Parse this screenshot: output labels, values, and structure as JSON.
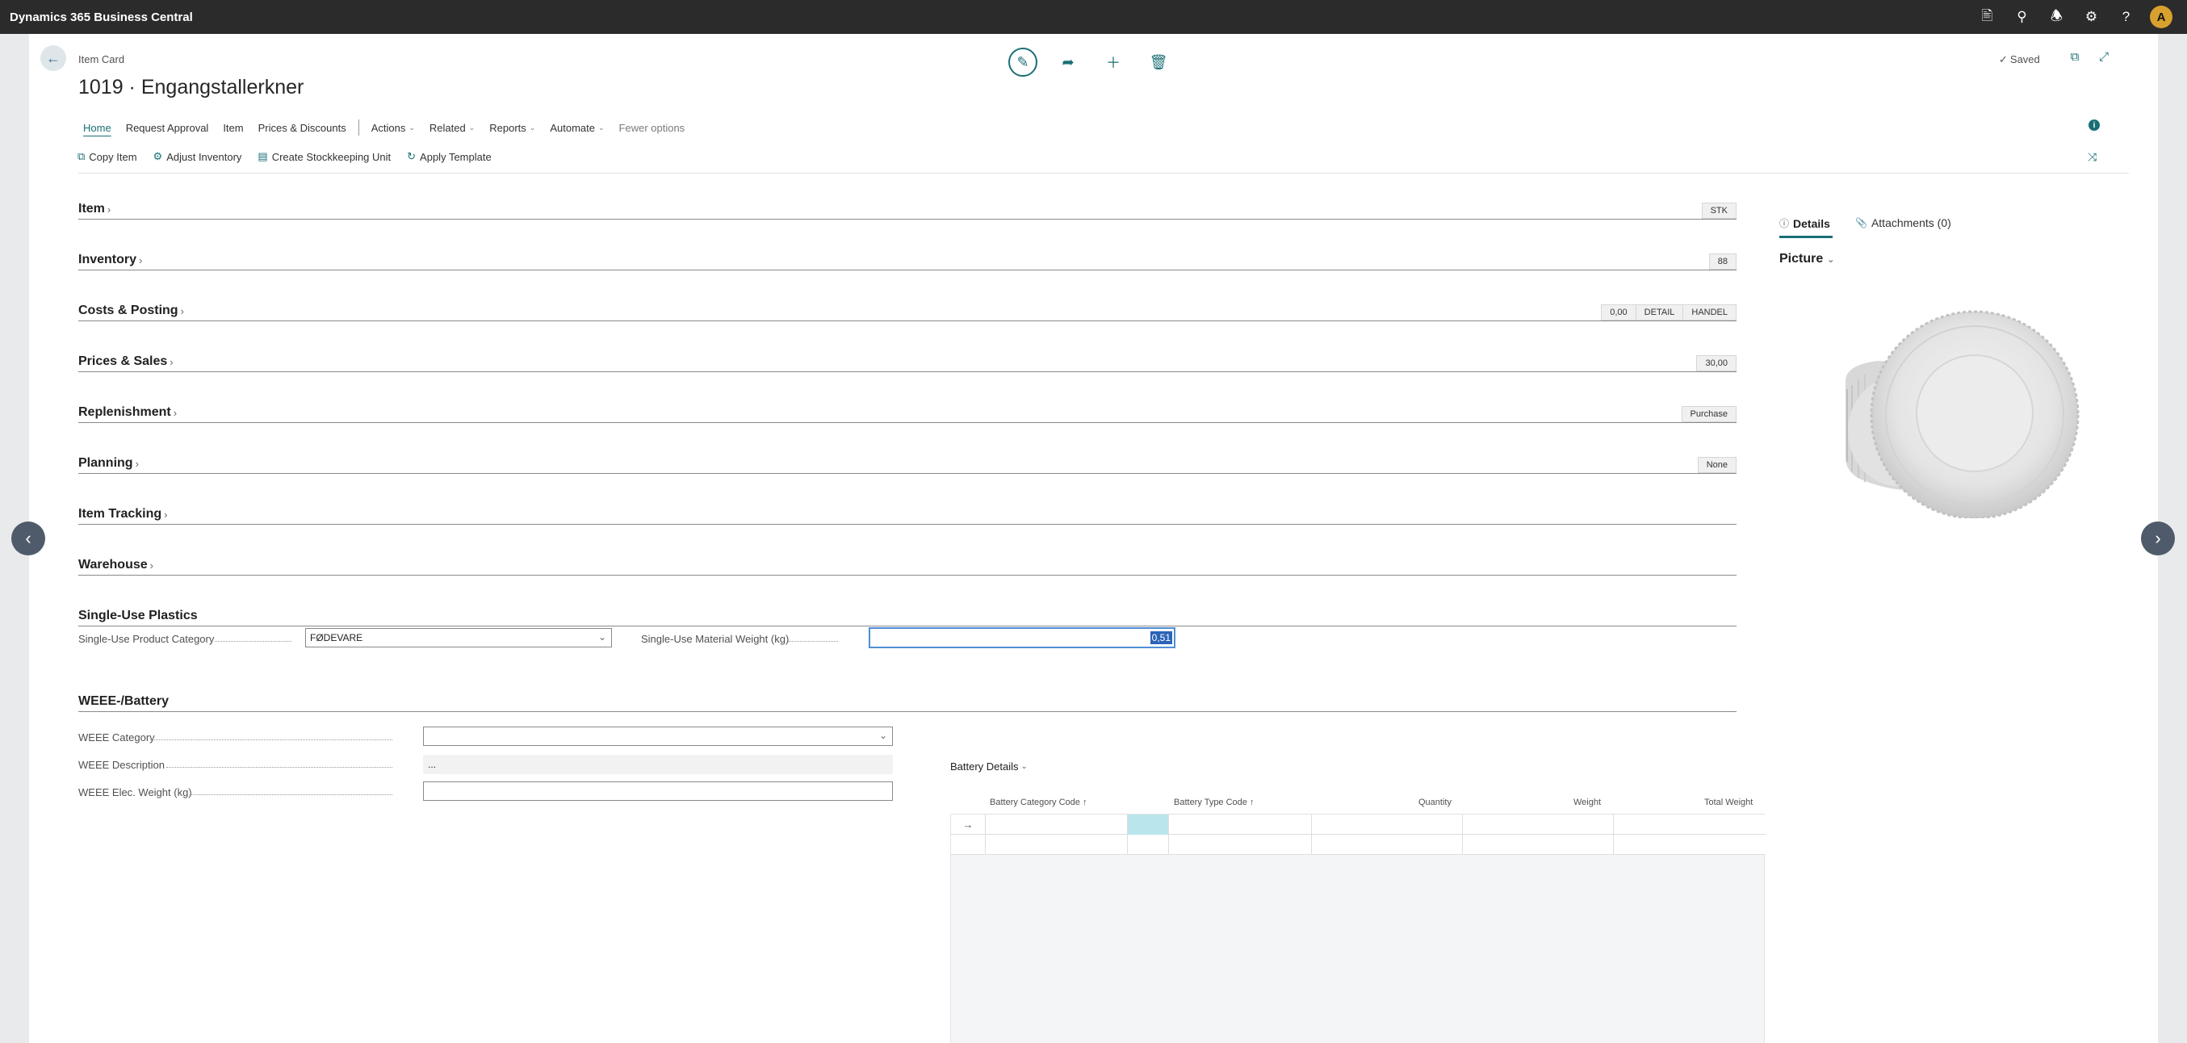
{
  "app": {
    "title": "Dynamics 365 Business Central",
    "user_initial": "A"
  },
  "header": {
    "caption": "Item Card",
    "title": "1019 · Engangstallerkner",
    "saved": "Saved"
  },
  "menu": {
    "home": "Home",
    "request_approval": "Request Approval",
    "item": "Item",
    "prices_discounts": "Prices & Discounts",
    "actions": "Actions",
    "related": "Related",
    "reports": "Reports",
    "automate": "Automate",
    "fewer_options": "Fewer options"
  },
  "actionbar": {
    "copy_item": "Copy Item",
    "adjust_inventory": "Adjust Inventory",
    "create_sku": "Create Stockkeeping Unit",
    "apply_template": "Apply Template"
  },
  "fasttabs": [
    {
      "title": "Item",
      "promoted": [
        "STK"
      ]
    },
    {
      "title": "Inventory",
      "promoted": [
        "88"
      ]
    },
    {
      "title": "Costs & Posting",
      "promoted": [
        "0,00",
        "DETAIL",
        "HANDEL"
      ]
    },
    {
      "title": "Prices & Sales",
      "promoted": [
        "30,00"
      ]
    },
    {
      "title": "Replenishment",
      "promoted": [
        "Purchase"
      ]
    },
    {
      "title": "Planning",
      "promoted": [
        "None"
      ]
    },
    {
      "title": "Item Tracking",
      "promoted": []
    },
    {
      "title": "Warehouse",
      "promoted": []
    },
    {
      "title": "Single-Use Plastics",
      "promoted": []
    },
    {
      "title": "WEEE-/Battery",
      "promoted": []
    }
  ],
  "single_use": {
    "category_label": "Single-Use Product Category",
    "category_value": "FØDEVARE",
    "weight_label": "Single-Use Material Weight (kg)",
    "weight_value": "0,51"
  },
  "weee": {
    "category_label": "WEEE Category",
    "category_value": "",
    "description_label": "WEEE Description",
    "description_value": "...",
    "elec_weight_label": "WEEE Elec. Weight (kg)",
    "elec_weight_value": ""
  },
  "battery": {
    "title": "Battery Details",
    "columns": [
      "Battery Category Code ↑",
      "Battery Type Code ↑",
      "Quantity",
      "Weight",
      "Total Weight"
    ]
  },
  "factbox": {
    "details": "Details",
    "attachments": "Attachments (0)",
    "picture": "Picture"
  },
  "colors": {
    "accent": "#1a6f75",
    "appbar": "#2b2b2b",
    "avatar": "#d8a12f",
    "selected_cell": "#b9e6ec"
  }
}
